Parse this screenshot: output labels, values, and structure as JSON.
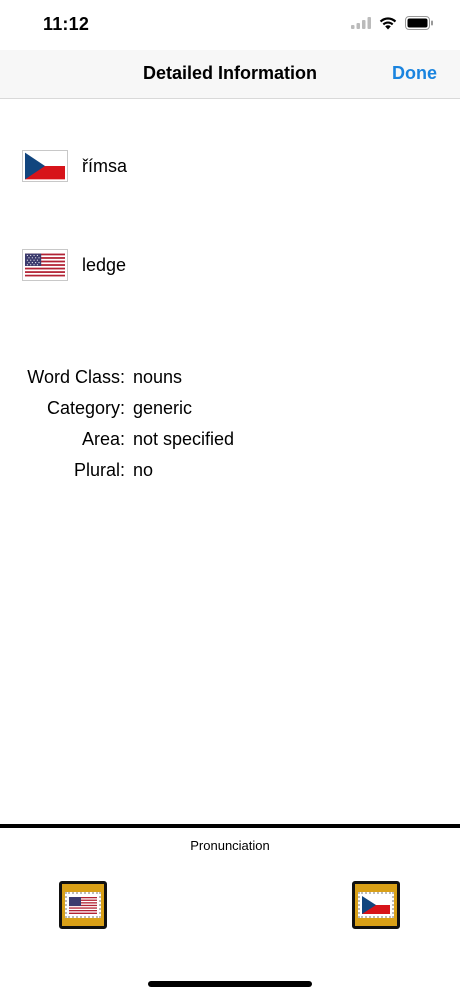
{
  "status_bar": {
    "time": "11:12",
    "icons": [
      "cellular-signal-icon",
      "wifi-icon",
      "battery-icon"
    ]
  },
  "nav": {
    "title": "Detailed Information",
    "done_label": "Done",
    "accent_color": "#1a84df"
  },
  "words": [
    {
      "language": "czech",
      "flag": "czech-flag-icon",
      "text": "římsa"
    },
    {
      "language": "english-us",
      "flag": "us-flag-icon",
      "text": "ledge"
    }
  ],
  "details": [
    {
      "label": "Word Class:",
      "value": "nouns"
    },
    {
      "label": "Category:",
      "value": "generic"
    },
    {
      "label": "Area:",
      "value": "not specified"
    },
    {
      "label": "Plural:",
      "value": "no"
    }
  ],
  "pronunciation": {
    "label": "Pronunciation",
    "buttons": [
      {
        "language": "english-us",
        "icon": "us-flag-icon"
      },
      {
        "language": "czech",
        "icon": "czech-flag-icon"
      }
    ],
    "button_color": "#d9a017"
  }
}
